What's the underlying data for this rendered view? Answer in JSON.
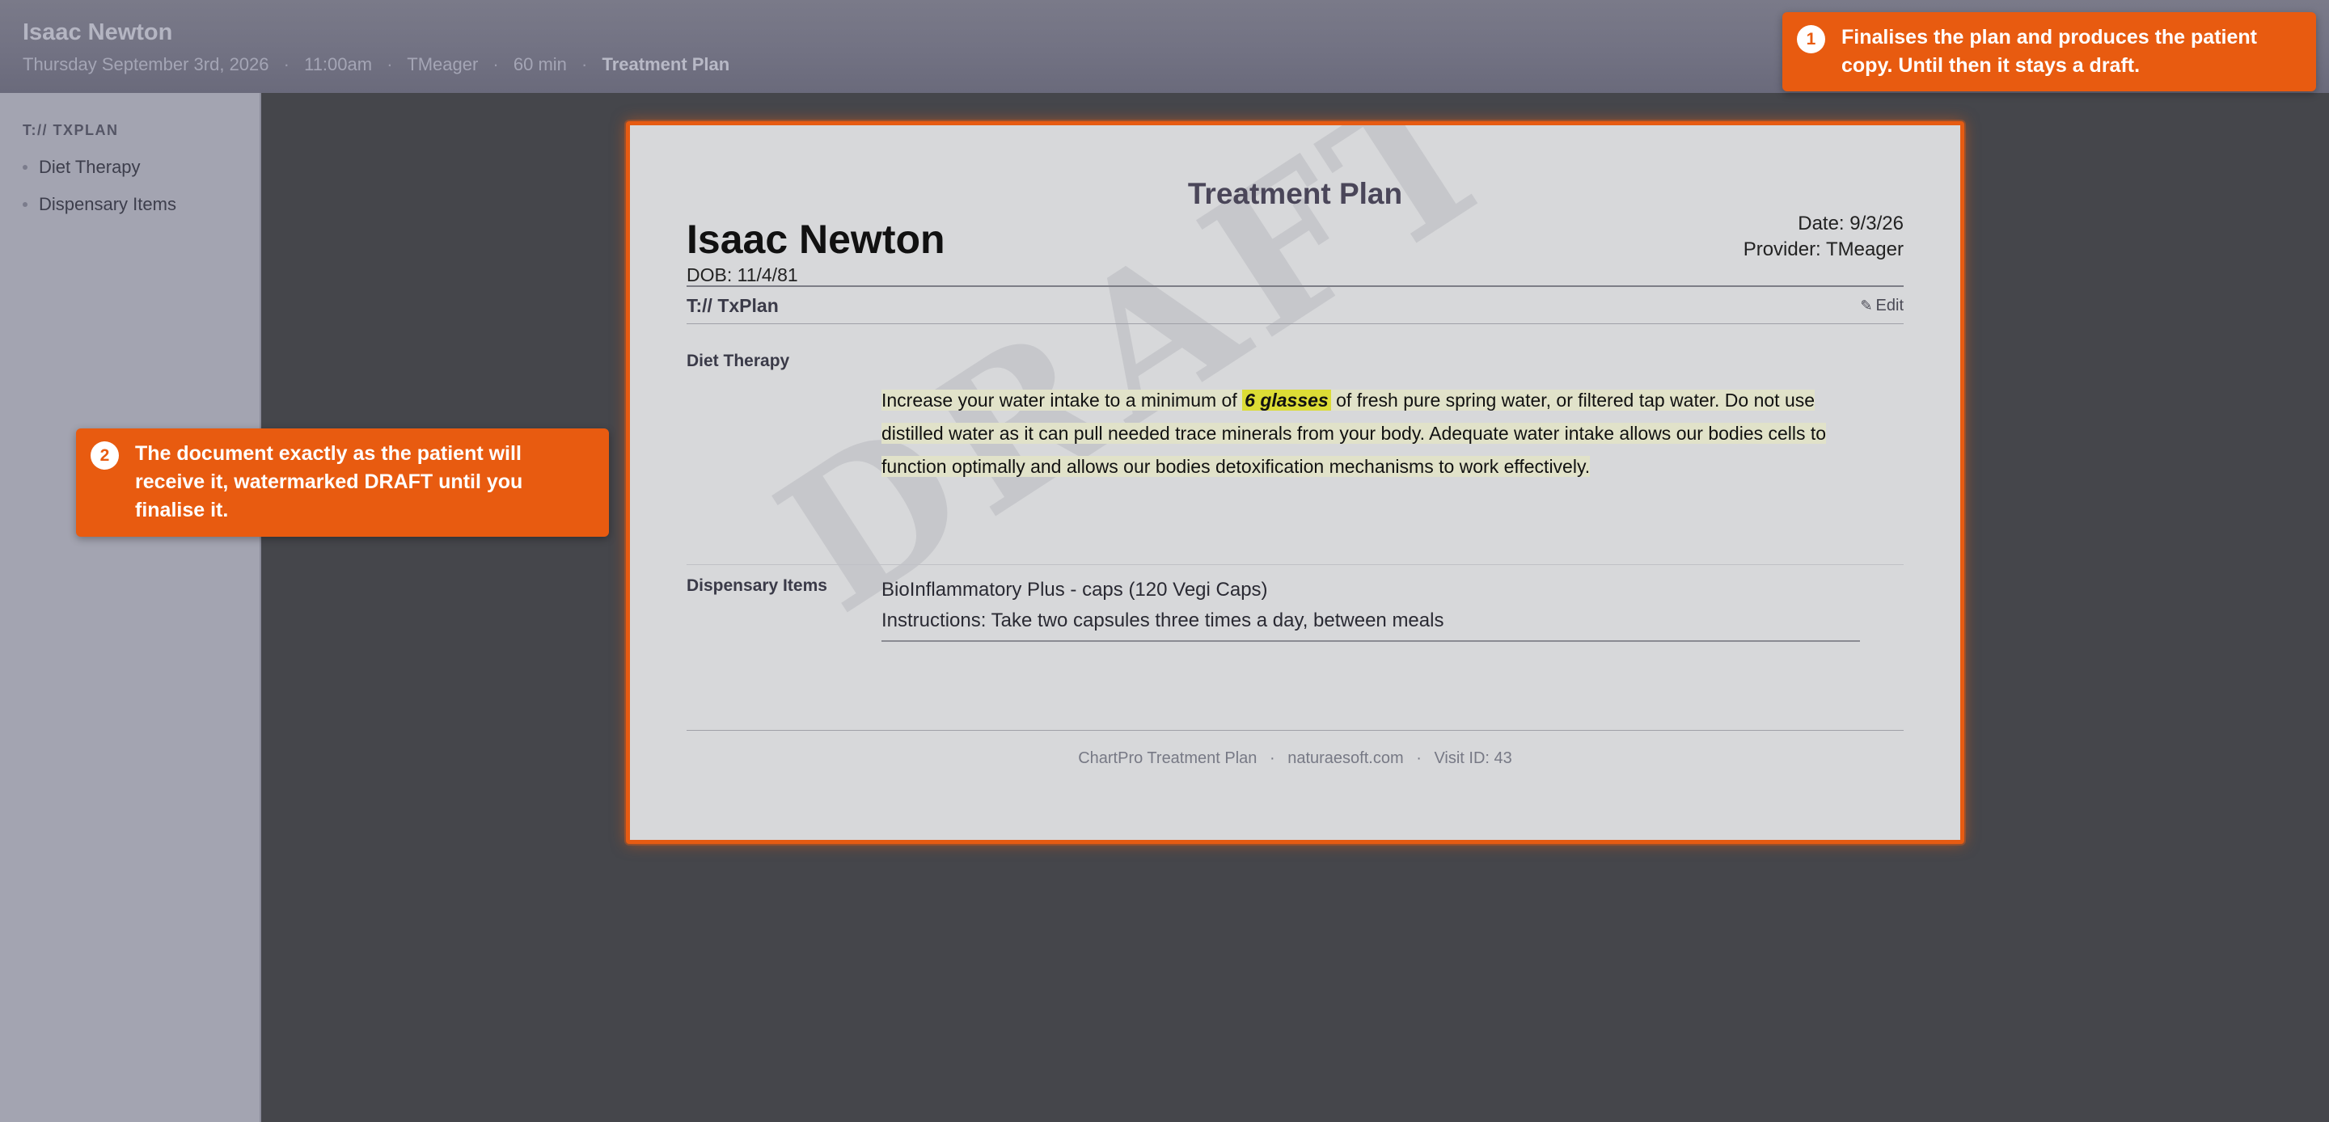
{
  "header": {
    "patient_name": "Isaac Newton",
    "date": "Thursday September 3rd, 2026",
    "time": "11:00am",
    "provider": "TMeager",
    "duration": "60 min",
    "current_view": "Treatment Plan",
    "separator": "·"
  },
  "sidebar": {
    "section_label": "T:// TXPLAN",
    "items": [
      {
        "label": "Diet Therapy"
      },
      {
        "label": "Dispensary Items"
      }
    ]
  },
  "document": {
    "title": "Treatment Plan",
    "patient_name": "Isaac Newton",
    "dob": "DOB: 11/4/81",
    "date": "Date: 9/3/26",
    "provider": "Provider: TMeager",
    "section_title": "T:// TxPlan",
    "edit_label": "Edit",
    "watermark": "DRAFT",
    "diet_therapy": {
      "label": "Diet Therapy",
      "text_before": "Increase your water intake to a minimum of ",
      "highlight": "6 glasses",
      "text_after": " of fresh pure spring water, or filtered tap water. Do not use distilled water as it can pull needed trace minerals from your body. Adequate water intake allows our bodies cells to function optimally and allows our bodies detoxification mechanisms to work effectively."
    },
    "dispensary": {
      "label": "Dispensary Items",
      "item_name": "BioInflammatory Plus - caps (120 Vegi Caps)",
      "instructions": "Instructions: Take two capsules three times a day, between meals"
    },
    "footer": {
      "product": "ChartPro Treatment Plan",
      "site": "naturaesoft.com",
      "visit": "Visit ID: 43",
      "separator": "·"
    }
  },
  "callouts": [
    {
      "number": "1",
      "text": "Finalises the plan and produces the patient copy. Until then it stays a draft."
    },
    {
      "number": "2",
      "text": "The document exactly as the patient will receive it, watermarked DRAFT until you finalise it."
    }
  ],
  "colors": {
    "accent": "#e85b10",
    "highlight": "#dcdc35",
    "background": "#45464b"
  }
}
